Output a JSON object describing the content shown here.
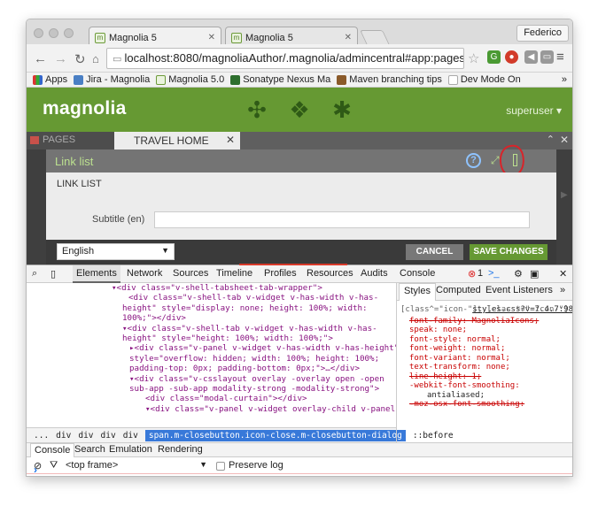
{
  "browser": {
    "tabs": [
      {
        "label": "Magnolia 5",
        "favicon": "magnolia-favicon"
      },
      {
        "label": "Magnolia 5",
        "favicon": "magnolia-favicon"
      }
    ],
    "user": "Federico",
    "url": "localhost:8080/magnoliaAuthor/.magnolia/admincentral#app:pages:...",
    "bookmarks": [
      {
        "label": "Apps"
      },
      {
        "label": "Jira - Magnolia"
      },
      {
        "label": "Magnolia 5.0"
      },
      {
        "label": "Sonatype Nexus Ma"
      },
      {
        "label": "Maven branching tips"
      },
      {
        "label": "Dev Mode On"
      }
    ],
    "bookmarks_more": "»"
  },
  "magnolia": {
    "logo": "magnolia",
    "user_label": "superuser",
    "app_tabs": {
      "pages": "PAGES",
      "travel": "TRAVEL HOME"
    },
    "dialog": {
      "title": "Link list",
      "section": "LINK LIST",
      "field_label": "Subtitle (en)",
      "field_value": "",
      "language": "English",
      "cancel": "CANCEL",
      "save": "SAVE CHANGES"
    }
  },
  "devtools": {
    "tabs": [
      "Elements",
      "Network",
      "Sources",
      "Timeline",
      "Profiles",
      "Resources",
      "Audits",
      "Console"
    ],
    "error_count": "1",
    "style_tabs": [
      "Styles",
      "Computed",
      "Event Listeners"
    ],
    "dom_lines": [
      {
        "t": "▾<div class=\"v-shell-tabsheet-tab-wrapper\">"
      },
      {
        "t": "<div class=\"v-shell-tab v-widget v-has-width v-has-"
      },
      {
        "t": "height\" style=\"display: none; height: 100%; width:"
      },
      {
        "t": "100%;\"></div>"
      },
      {
        "t": "▾<div class=\"v-shell-tab v-widget v-has-width v-has-"
      },
      {
        "t": "height\" style=\"height: 100%; width: 100%;\">"
      },
      {
        "t": "▸<div class=\"v-panel v-widget v-has-width v-has-height\""
      },
      {
        "t": "style=\"overflow: hidden; width: 100%; height: 100%;"
      },
      {
        "t": "padding-top: 0px; padding-bottom: 0px;\">…</div>"
      },
      {
        "t": "▾<div class=\"v-csslayout overlay -overlay open -open"
      },
      {
        "t": "sub-app -sub-app modality-strong -modality-strong\">"
      },
      {
        "t": "<div class=\"modal-curtain\"></div>"
      },
      {
        "t": "▾<div class=\"v-panel v-widget overlay-child v-panel"
      }
    ],
    "breadcrumbs": [
      "...",
      "div",
      "div",
      "div",
      "div"
    ],
    "selected_crumb": "span.m-closebutton.icon-close.m-closebutton-dialog",
    "after_crumb": "::before",
    "styles": {
      "selector": "[class^=\"icon-\"], [class*=\" icon-\"] {",
      "source": "styles.css?v=7.4.7:98",
      "props": [
        {
          "text": "font-family: MagnoliaIcons;",
          "struck": true
        },
        {
          "text": "speak: none;",
          "struck": false
        },
        {
          "text": "font-style: normal;",
          "struck": false
        },
        {
          "text": "font-weight: normal;",
          "struck": false
        },
        {
          "text": "font-variant: normal;",
          "struck": false
        },
        {
          "text": "text-transform: none;",
          "struck": false
        },
        {
          "text": "line-height: 1;",
          "struck": true
        },
        {
          "text": "-webkit-font-smoothing:",
          "struck": false
        },
        {
          "text": "antialiased;",
          "struck": false
        },
        {
          "text": "-moz-osx-font-smoothing:",
          "struck": true
        }
      ]
    },
    "console_tabs": [
      "Console",
      "Search",
      "Emulation",
      "Rendering"
    ],
    "frame": "<top frame>",
    "preserve_log": "Preserve log",
    "prompt": "›"
  }
}
